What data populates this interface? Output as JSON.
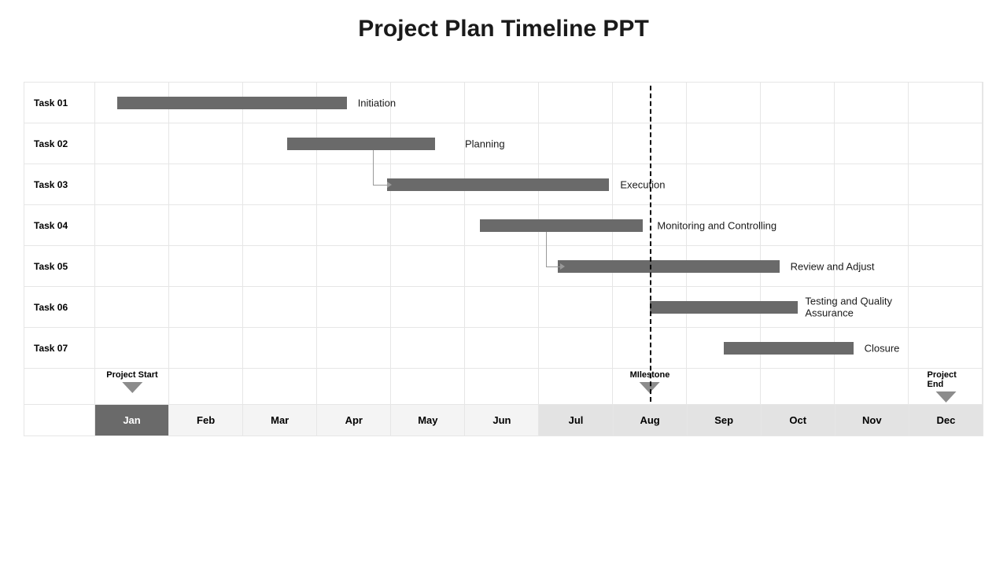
{
  "title": "Project Plan Timeline PPT",
  "months": [
    "Jan",
    "Feb",
    "Mar",
    "Apr",
    "May",
    "Jun",
    "Jul",
    "Aug",
    "Sep",
    "Oct",
    "Nov",
    "Dec"
  ],
  "month_styles": [
    "active",
    "",
    "",
    "",
    "",
    "",
    "light",
    "light",
    "light",
    "light",
    "light",
    "light"
  ],
  "tasks": [
    {
      "id": "Task 01",
      "name": "Initiation",
      "start": 0.3,
      "width": 3.1,
      "label_offset": 3.55
    },
    {
      "id": "Task 02",
      "name": "Planning",
      "start": 2.6,
      "width": 2.0,
      "label_offset": 5.0
    },
    {
      "id": "Task 03",
      "name": "Execution",
      "start": 3.95,
      "width": 3.0,
      "label_offset": 7.1
    },
    {
      "id": "Task 04",
      "name": "Monitoring and Controlling",
      "start": 5.2,
      "width": 2.2,
      "label_offset": 7.6
    },
    {
      "id": "Task 05",
      "name": "Review and Adjust",
      "start": 6.25,
      "width": 3.0,
      "label_offset": 9.4
    },
    {
      "id": "Task 06",
      "name": "Testing and Quality Assurance",
      "start": 7.5,
      "width": 2.0,
      "label_offset": 9.6
    },
    {
      "id": "Task 07",
      "name": "Closure",
      "start": 8.5,
      "width": 1.75,
      "label_offset": 10.4
    }
  ],
  "markers": [
    {
      "label": "Project Start",
      "month": 0.5
    },
    {
      "label": "MIlestone",
      "month": 7.5
    },
    {
      "label": "Project End",
      "month": 11.5
    }
  ],
  "milestone_line_month": 7.5,
  "chart_data": {
    "type": "gantt",
    "title": "Project Plan Timeline PPT",
    "x_categories": [
      "Jan",
      "Feb",
      "Mar",
      "Apr",
      "May",
      "Jun",
      "Jul",
      "Aug",
      "Sep",
      "Oct",
      "Nov",
      "Dec"
    ],
    "tasks": [
      {
        "id": "Task 01",
        "name": "Initiation",
        "start_month": "Jan",
        "end_month": "Apr"
      },
      {
        "id": "Task 02",
        "name": "Planning",
        "start_month": "Mar",
        "end_month": "May"
      },
      {
        "id": "Task 03",
        "name": "Execution",
        "start_month": "Apr",
        "end_month": "Jul"
      },
      {
        "id": "Task 04",
        "name": "Monitoring and Controlling",
        "start_month": "Jun",
        "end_month": "Aug"
      },
      {
        "id": "Task 05",
        "name": "Review and Adjust",
        "start_month": "Jul",
        "end_month": "Oct"
      },
      {
        "id": "Task 06",
        "name": "Testing and Quality Assurance",
        "start_month": "Aug",
        "end_month": "Oct"
      },
      {
        "id": "Task 07",
        "name": "Closure",
        "start_month": "Sep",
        "end_month": "Nov"
      }
    ],
    "dependencies": [
      [
        "Task 02",
        "Task 03"
      ],
      [
        "Task 04",
        "Task 05"
      ]
    ],
    "milestones": [
      {
        "label": "Project Start",
        "month": "Jan"
      },
      {
        "label": "MIlestone",
        "month": "Aug"
      },
      {
        "label": "Project End",
        "month": "Dec"
      }
    ]
  }
}
